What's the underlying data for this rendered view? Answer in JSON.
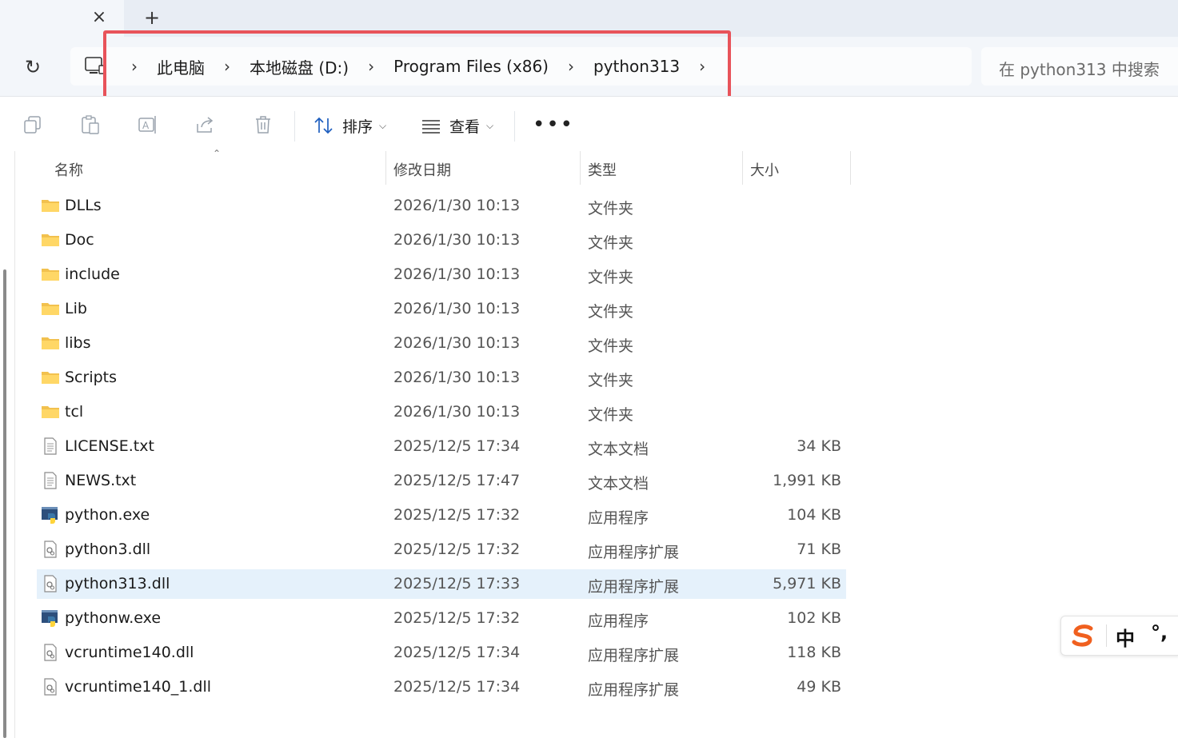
{
  "tabs": {
    "close_icon": "×",
    "new_tab_icon": "+"
  },
  "address": {
    "refresh_icon": "↻",
    "crumb_separator": "›",
    "crumbs": [
      "此电脑",
      "本地磁盘 (D:)",
      "Program Files (x86)",
      "python313"
    ],
    "highlight_color": "#e8535a"
  },
  "search": {
    "placeholder": "在 python313 中搜索"
  },
  "toolbar": {
    "sort_label": "排序",
    "view_label": "查看",
    "more_label": "•••",
    "icons": [
      "copy-icon",
      "paste-icon",
      "rename-icon",
      "share-icon",
      "delete-icon",
      "sort-icon",
      "view-icon",
      "more-icon"
    ]
  },
  "columns": {
    "name": "名称",
    "date": "修改日期",
    "type": "类型",
    "size": "大小"
  },
  "files": [
    {
      "name": "DLLs",
      "date": "2026/1/30 10:13",
      "type": "文件夹",
      "size": "",
      "icon": "folder-icon"
    },
    {
      "name": "Doc",
      "date": "2026/1/30 10:13",
      "type": "文件夹",
      "size": "",
      "icon": "folder-icon"
    },
    {
      "name": "include",
      "date": "2026/1/30 10:13",
      "type": "文件夹",
      "size": "",
      "icon": "folder-icon"
    },
    {
      "name": "Lib",
      "date": "2026/1/30 10:13",
      "type": "文件夹",
      "size": "",
      "icon": "folder-icon"
    },
    {
      "name": "libs",
      "date": "2026/1/30 10:13",
      "type": "文件夹",
      "size": "",
      "icon": "folder-icon"
    },
    {
      "name": "Scripts",
      "date": "2026/1/30 10:13",
      "type": "文件夹",
      "size": "",
      "icon": "folder-icon"
    },
    {
      "name": "tcl",
      "date": "2026/1/30 10:13",
      "type": "文件夹",
      "size": "",
      "icon": "folder-icon"
    },
    {
      "name": "LICENSE.txt",
      "date": "2025/12/5 17:34",
      "type": "文本文档",
      "size": "34 KB",
      "icon": "text-file-icon"
    },
    {
      "name": "NEWS.txt",
      "date": "2025/12/5 17:47",
      "type": "文本文档",
      "size": "1,991 KB",
      "icon": "text-file-icon"
    },
    {
      "name": "python.exe",
      "date": "2025/12/5 17:32",
      "type": "应用程序",
      "size": "104 KB",
      "icon": "python-exe-icon"
    },
    {
      "name": "python3.dll",
      "date": "2025/12/5 17:32",
      "type": "应用程序扩展",
      "size": "71 KB",
      "icon": "dll-file-icon"
    },
    {
      "name": "python313.dll",
      "date": "2025/12/5 17:33",
      "type": "应用程序扩展",
      "size": "5,971 KB",
      "icon": "dll-file-icon",
      "selected": true
    },
    {
      "name": "pythonw.exe",
      "date": "2025/12/5 17:32",
      "type": "应用程序",
      "size": "102 KB",
      "icon": "python-exe-icon"
    },
    {
      "name": "vcruntime140.dll",
      "date": "2025/12/5 17:34",
      "type": "应用程序扩展",
      "size": "118 KB",
      "icon": "dll-file-icon"
    },
    {
      "name": "vcruntime140_1.dll",
      "date": "2025/12/5 17:34",
      "type": "应用程序扩展",
      "size": "49 KB",
      "icon": "dll-file-icon"
    }
  ],
  "ime": {
    "mode": "中",
    "punct": "°,",
    "logo_color": "#f0601f"
  }
}
